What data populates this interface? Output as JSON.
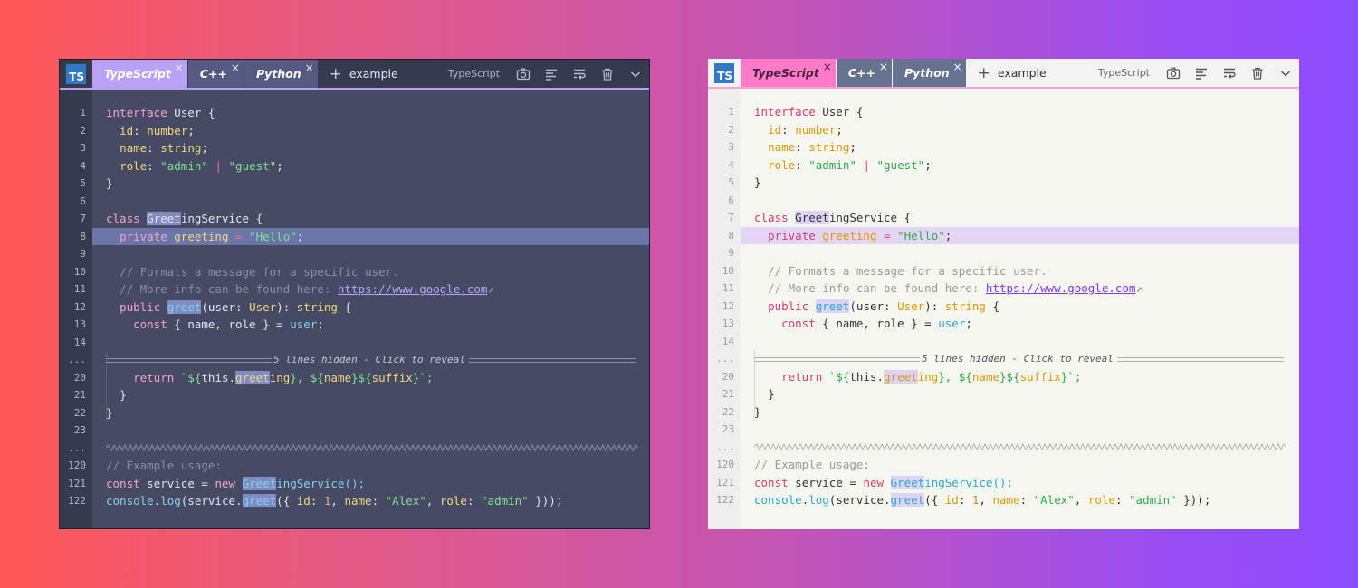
{
  "tabs": [
    {
      "label": "TypeScript",
      "close": "×"
    },
    {
      "label": "C++",
      "close": "×"
    },
    {
      "label": "Python",
      "close": "×"
    }
  ],
  "logo_text": "TS",
  "add_tab": "+",
  "tab_name": "example",
  "language_label": "TypeScript",
  "toolbar_icons": [
    "camera-icon",
    "format-icon",
    "wrap-icon",
    "trash-icon",
    "chevron-down-icon"
  ],
  "fold": {
    "text": "5 lines hidden - Click to reveal",
    "number": "...",
    "number2": "..."
  },
  "line_numbers": [
    "1",
    "2",
    "3",
    "4",
    "5",
    "6",
    "7",
    "8",
    "9",
    "10",
    "11",
    "12",
    "13",
    "14",
    "20",
    "21",
    "22",
    "23",
    "120",
    "121",
    "122"
  ],
  "code": {
    "l1a": "interface",
    "l1b": " User {",
    "l2a": "id",
    "l2b": ": ",
    "l2c": "number",
    "l2d": ";",
    "l3a": "name",
    "l3b": ": ",
    "l3c": "string",
    "l3d": ";",
    "l4a": "role",
    "l4b": ": ",
    "l4c": "\"admin\"",
    "l4d": " | ",
    "l4e": "\"guest\"",
    "l4f": ";",
    "l5": "}",
    "l7a": "class",
    "l7b": " ",
    "l7c": "Greet",
    "l7d": "ingService {",
    "l8a": "private",
    "l8b": " ",
    "l8c": "greeting",
    "l8d": " = ",
    "l8e": "\"Hello\"",
    "l8f": ";",
    "l10": "// Formats a message for a specific user.",
    "l11a": "// More info can be found here: ",
    "l11b": "https://www.google.com",
    "l12a": "public",
    "l12b": " ",
    "l12c": "greet",
    "l12d": "(user: ",
    "l12e": "User",
    "l12f": "): ",
    "l12g": "string",
    "l12h": " {",
    "l13a": "const",
    "l13b": " { name, role } = ",
    "l13c": "user",
    "l13d": ";",
    "l20a": "return",
    "l20b": " `",
    "l20c": "${",
    "l20d": "this.",
    "l20e": "greet",
    "l20f": "ing",
    "l20g": "}",
    "l20h": ", ",
    "l20i": "${",
    "l20j": "name",
    "l20k": "}",
    "l20l": "${",
    "l20m": "suffix",
    "l20n": "}",
    "l20o": "`;",
    "l21": "}",
    "l22": "}",
    "l120": "// Example usage:",
    "l121a": "const",
    "l121b": " service = ",
    "l121c": "new",
    "l121d": " ",
    "l121e": "Greet",
    "l121f": "ingService();",
    "l122a": "console",
    "l122b": ".",
    "l122c": "log",
    "l122d": "(service.",
    "l122e": "greet",
    "l122f": "({ ",
    "l122g": "id",
    "l122h": ": ",
    "l122i": "1",
    "l122j": ", ",
    "l122k": "name",
    "l122l": ": ",
    "l122m": "\"Alex\"",
    "l122n": ", ",
    "l122o": "role",
    "l122p": ": ",
    "l122q": "\"admin\"",
    "l122r": " }));"
  },
  "colors": {
    "background_start": "#ff5757",
    "background_end": "#8c4dff",
    "dark_editor": "#464a62",
    "light_editor": "#f6f6f1",
    "dark_active_tab": "#b7a2f5",
    "light_active_tab": "#ff7ac7"
  }
}
